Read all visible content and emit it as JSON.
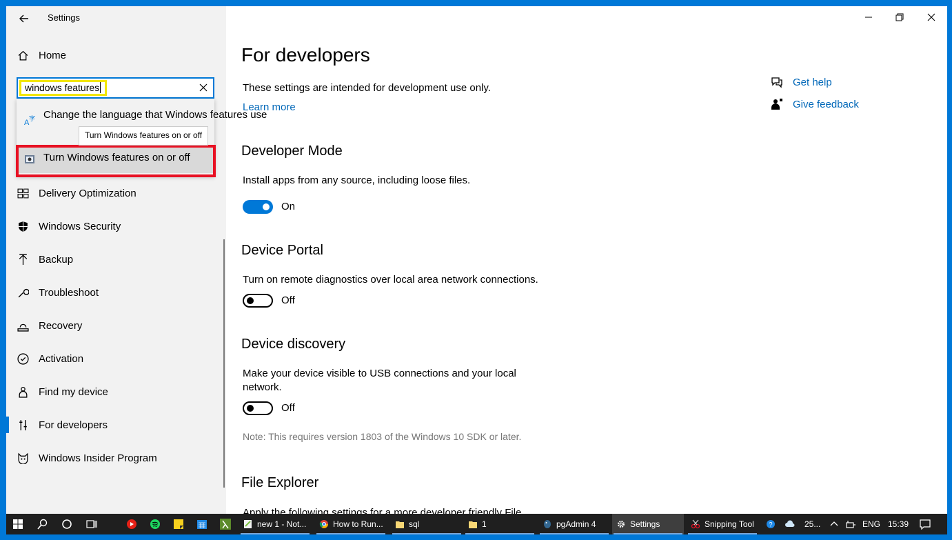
{
  "window": {
    "app_title": "Settings"
  },
  "search": {
    "value": "windows features",
    "suggestions": [
      {
        "label": "Change the language that Windows features use"
      },
      {
        "label": "Turn Windows features on or off"
      }
    ],
    "tooltip": "Turn Windows features on or off"
  },
  "sidebar": {
    "home_label": "Home",
    "items": [
      {
        "label": "Delivery Optimization",
        "icon": "delivery-optimization-icon"
      },
      {
        "label": "Windows Security",
        "icon": "shield-icon"
      },
      {
        "label": "Backup",
        "icon": "backup-arrow-icon"
      },
      {
        "label": "Troubleshoot",
        "icon": "wrench-icon"
      },
      {
        "label": "Recovery",
        "icon": "recovery-icon"
      },
      {
        "label": "Activation",
        "icon": "check-circle-icon"
      },
      {
        "label": "Find my device",
        "icon": "person-location-icon"
      },
      {
        "label": "For developers",
        "icon": "developer-tools-icon",
        "active": true
      },
      {
        "label": "Windows Insider Program",
        "icon": "insider-cat-icon"
      }
    ]
  },
  "main": {
    "title": "For developers",
    "intro": "These settings are intended for development use only.",
    "learn_more": "Learn more",
    "sections": [
      {
        "heading": "Developer Mode",
        "description": "Install apps from any source, including loose files.",
        "toggle_state": "On",
        "toggle_on": true
      },
      {
        "heading": "Device Portal",
        "description": "Turn on remote diagnostics over local area network connections.",
        "toggle_state": "Off",
        "toggle_on": false
      },
      {
        "heading": "Device discovery",
        "description_line1": "Make your device visible to USB connections and your local",
        "description_line2": "network.",
        "toggle_state": "Off",
        "toggle_on": false,
        "note": "Note: This requires version 1803 of the Windows 10 SDK or later."
      },
      {
        "heading": "File Explorer",
        "description": "Apply the following settings for a more developer friendly File"
      }
    ]
  },
  "help": {
    "get_help": "Get help",
    "give_feedback": "Give feedback"
  },
  "taskbar": {
    "apps": [
      {
        "label": "new 1 - Not...",
        "icon": "notepadpp-icon"
      },
      {
        "label": "How to Run...",
        "icon": "chrome-icon"
      },
      {
        "label": "sql",
        "icon": "folder-icon"
      },
      {
        "label": "1",
        "icon": "folder-icon"
      },
      {
        "label": "pgAdmin 4",
        "icon": "pgadmin-icon"
      },
      {
        "label": "Settings",
        "icon": "gear-icon",
        "active": true
      },
      {
        "label": "Snipping Tool",
        "icon": "snipping-tool-icon"
      }
    ],
    "weather": "25...",
    "language": "ENG",
    "time": "15:39"
  },
  "colors": {
    "accent": "#0078d7",
    "link": "#0067b8",
    "highlight_red": "#e81123",
    "highlight_yellow": "#f2e600"
  }
}
